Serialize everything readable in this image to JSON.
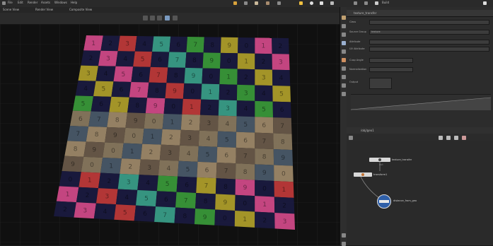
{
  "app": {
    "top_tabs": [
      "File",
      "Edit",
      "Render",
      "Assets",
      "Windows",
      "Help"
    ],
    "desktop_label": "Build"
  },
  "viewport": {
    "tabs": [
      "Scene View",
      "Render View",
      "Composite View"
    ],
    "grid_numbers": [
      "1",
      "2",
      "3",
      "4",
      "5",
      "6",
      "7",
      "8",
      "9",
      "0"
    ]
  },
  "params": {
    "node_title": "texture_transfer",
    "rows": [
      {
        "label": "Class",
        "value": ""
      },
      {
        "label": "Source Group",
        "value": "texture"
      },
      {
        "label": "Attribute",
        "value": ""
      },
      {
        "label": "UV Attribute",
        "value": ""
      },
      {
        "label": "Cusp Angle",
        "value": ""
      },
      {
        "label": "Normalization",
        "value": ""
      },
      {
        "label": "Output",
        "value": ""
      }
    ]
  },
  "network": {
    "path": "/obj/geo1",
    "nodes": [
      {
        "name": "texture_transfer",
        "sub": "out"
      },
      {
        "name": "transform1",
        "sub": ""
      },
      {
        "name": "distance_from_geo",
        "sub": ""
      }
    ]
  }
}
